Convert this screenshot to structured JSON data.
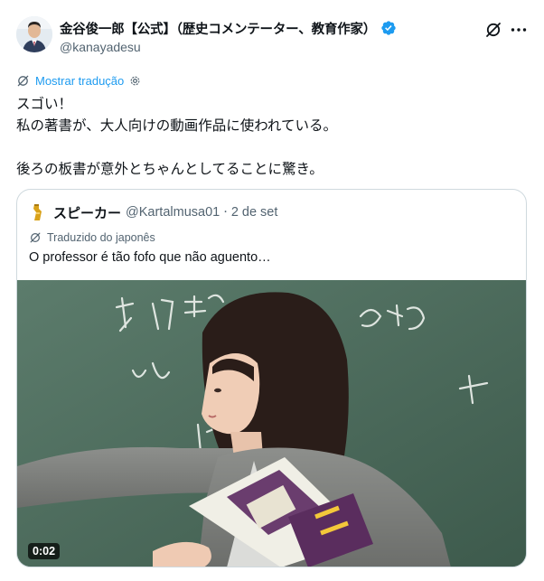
{
  "author": {
    "display_name": "金谷俊一郎【公式】（歴史コメンテーター、教育作家）",
    "handle": "@kanayadesu",
    "verified": true,
    "verified_color": "#1d9bf0"
  },
  "actions": {
    "grok_icon": "grok-slash-icon",
    "more_icon": "more-dots-icon"
  },
  "translate": {
    "label": "Mostrar tradução",
    "link_color": "#1d9bf0"
  },
  "tweet": {
    "lines": [
      "スゴい！",
      "私の著書が、大人向けの動画作品に使われている。",
      "",
      "後ろの板書が意外とちゃんとしてることに驚き。"
    ]
  },
  "quote": {
    "name": "スピーカー",
    "handle": "@Kartalmusa01",
    "separator": "·",
    "date": "2 de set",
    "translated_label": "Traduzido do japonês",
    "text": "O professor é tão fofo que não aguento…",
    "media": {
      "type": "video",
      "duration": "0:02"
    }
  }
}
